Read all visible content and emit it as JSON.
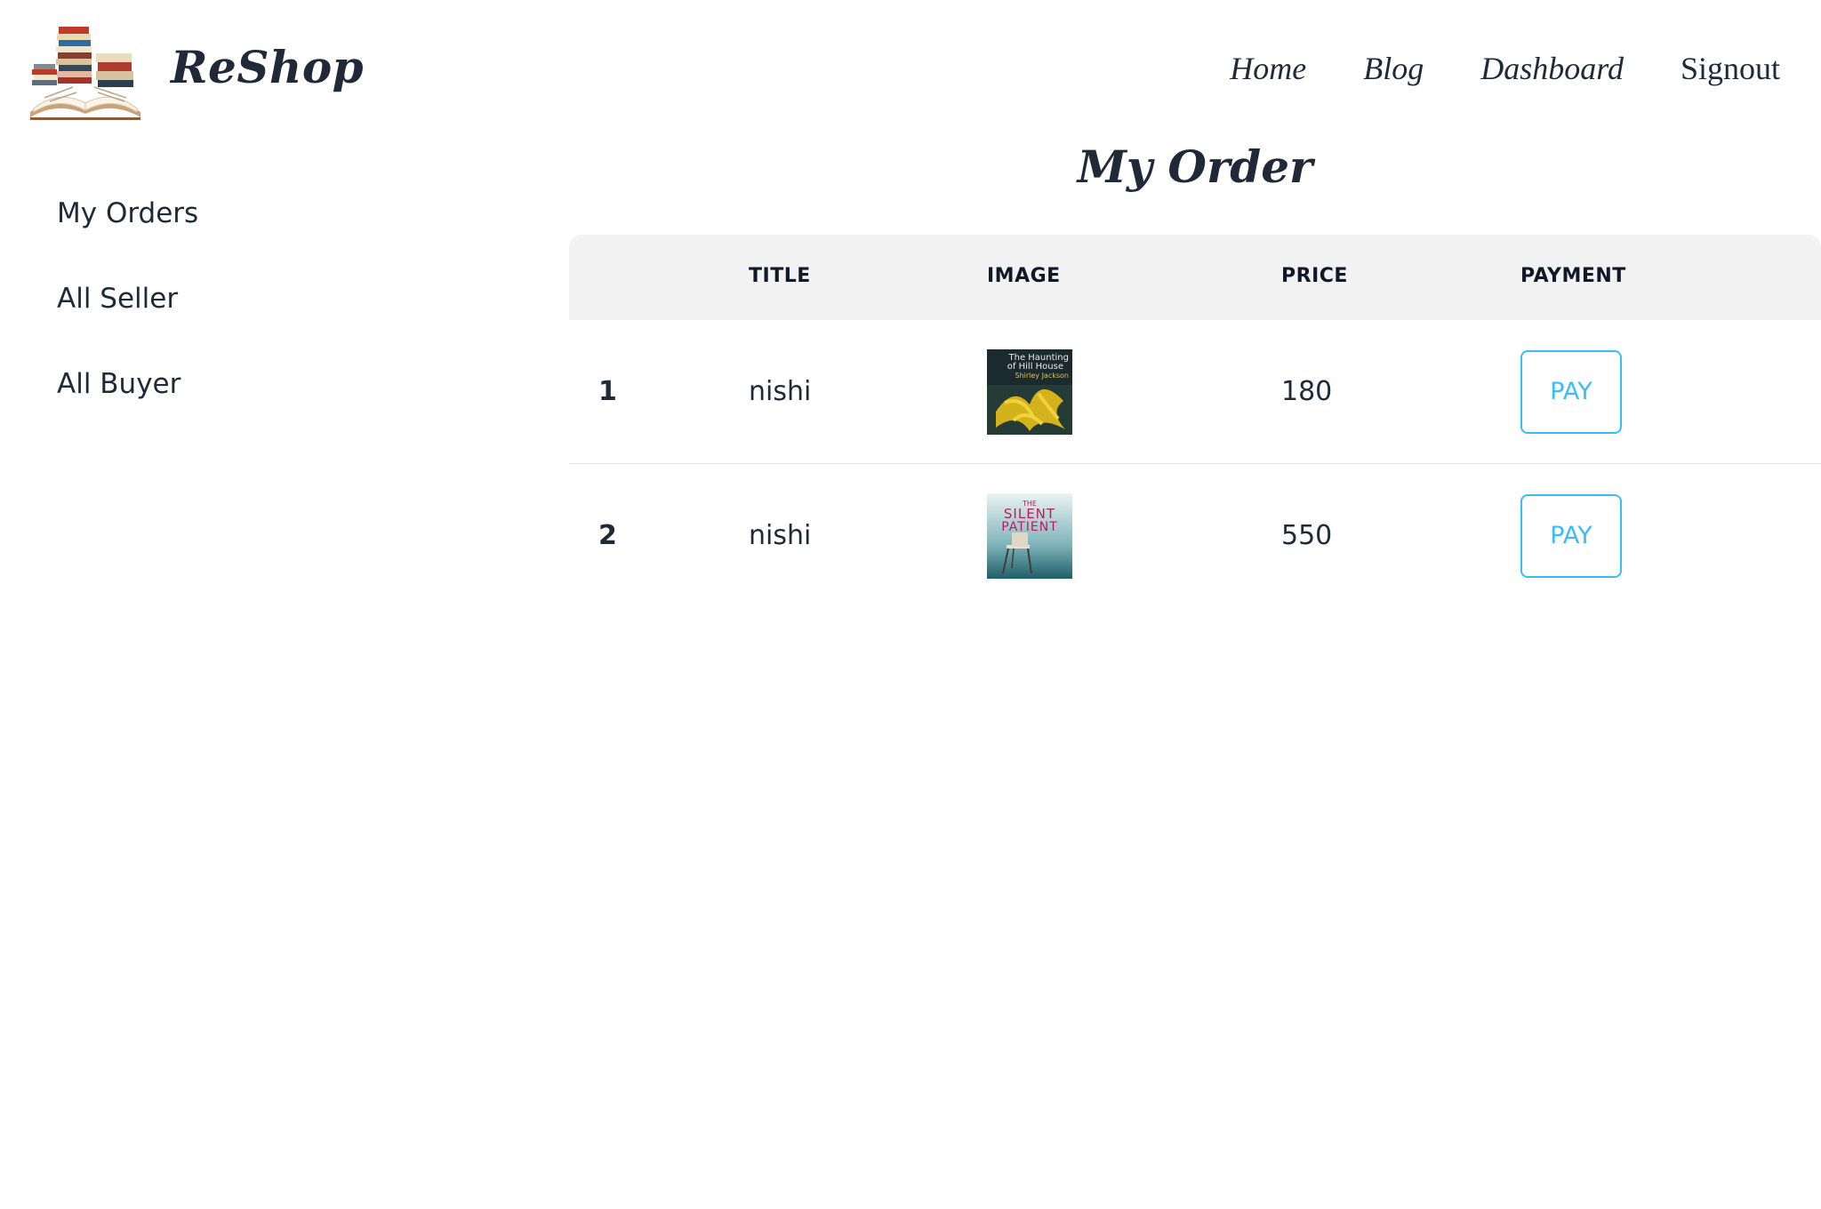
{
  "header": {
    "brand": "ReShop",
    "logo_icon": "books-stack-icon",
    "nav": [
      {
        "label": "Home"
      },
      {
        "label": "Blog"
      },
      {
        "label": "Dashboard"
      },
      {
        "label": "Signout"
      }
    ]
  },
  "sidebar": {
    "items": [
      {
        "label": "My Orders"
      },
      {
        "label": "All Seller"
      },
      {
        "label": "All Buyer"
      }
    ]
  },
  "main": {
    "title": "My Order",
    "table": {
      "columns": [
        "",
        "TITLE",
        "IMAGE",
        "PRICE",
        "PAYMENT"
      ],
      "rows": [
        {
          "index": "1",
          "title": "nishi",
          "image": {
            "line1": "The Haunting",
            "line2": "of Hill House",
            "line3": "Shirley Jackson"
          },
          "price": "180",
          "payment_label": "PAY"
        },
        {
          "index": "2",
          "title": "nishi",
          "image": {
            "line1": "THE",
            "line2": "SILENT",
            "line3": "PATIENT"
          },
          "price": "550",
          "payment_label": "PAY"
        }
      ]
    }
  },
  "colors": {
    "accent": "#38bdf8",
    "text": "#1f2937",
    "header_bg": "#f2f2f2"
  }
}
